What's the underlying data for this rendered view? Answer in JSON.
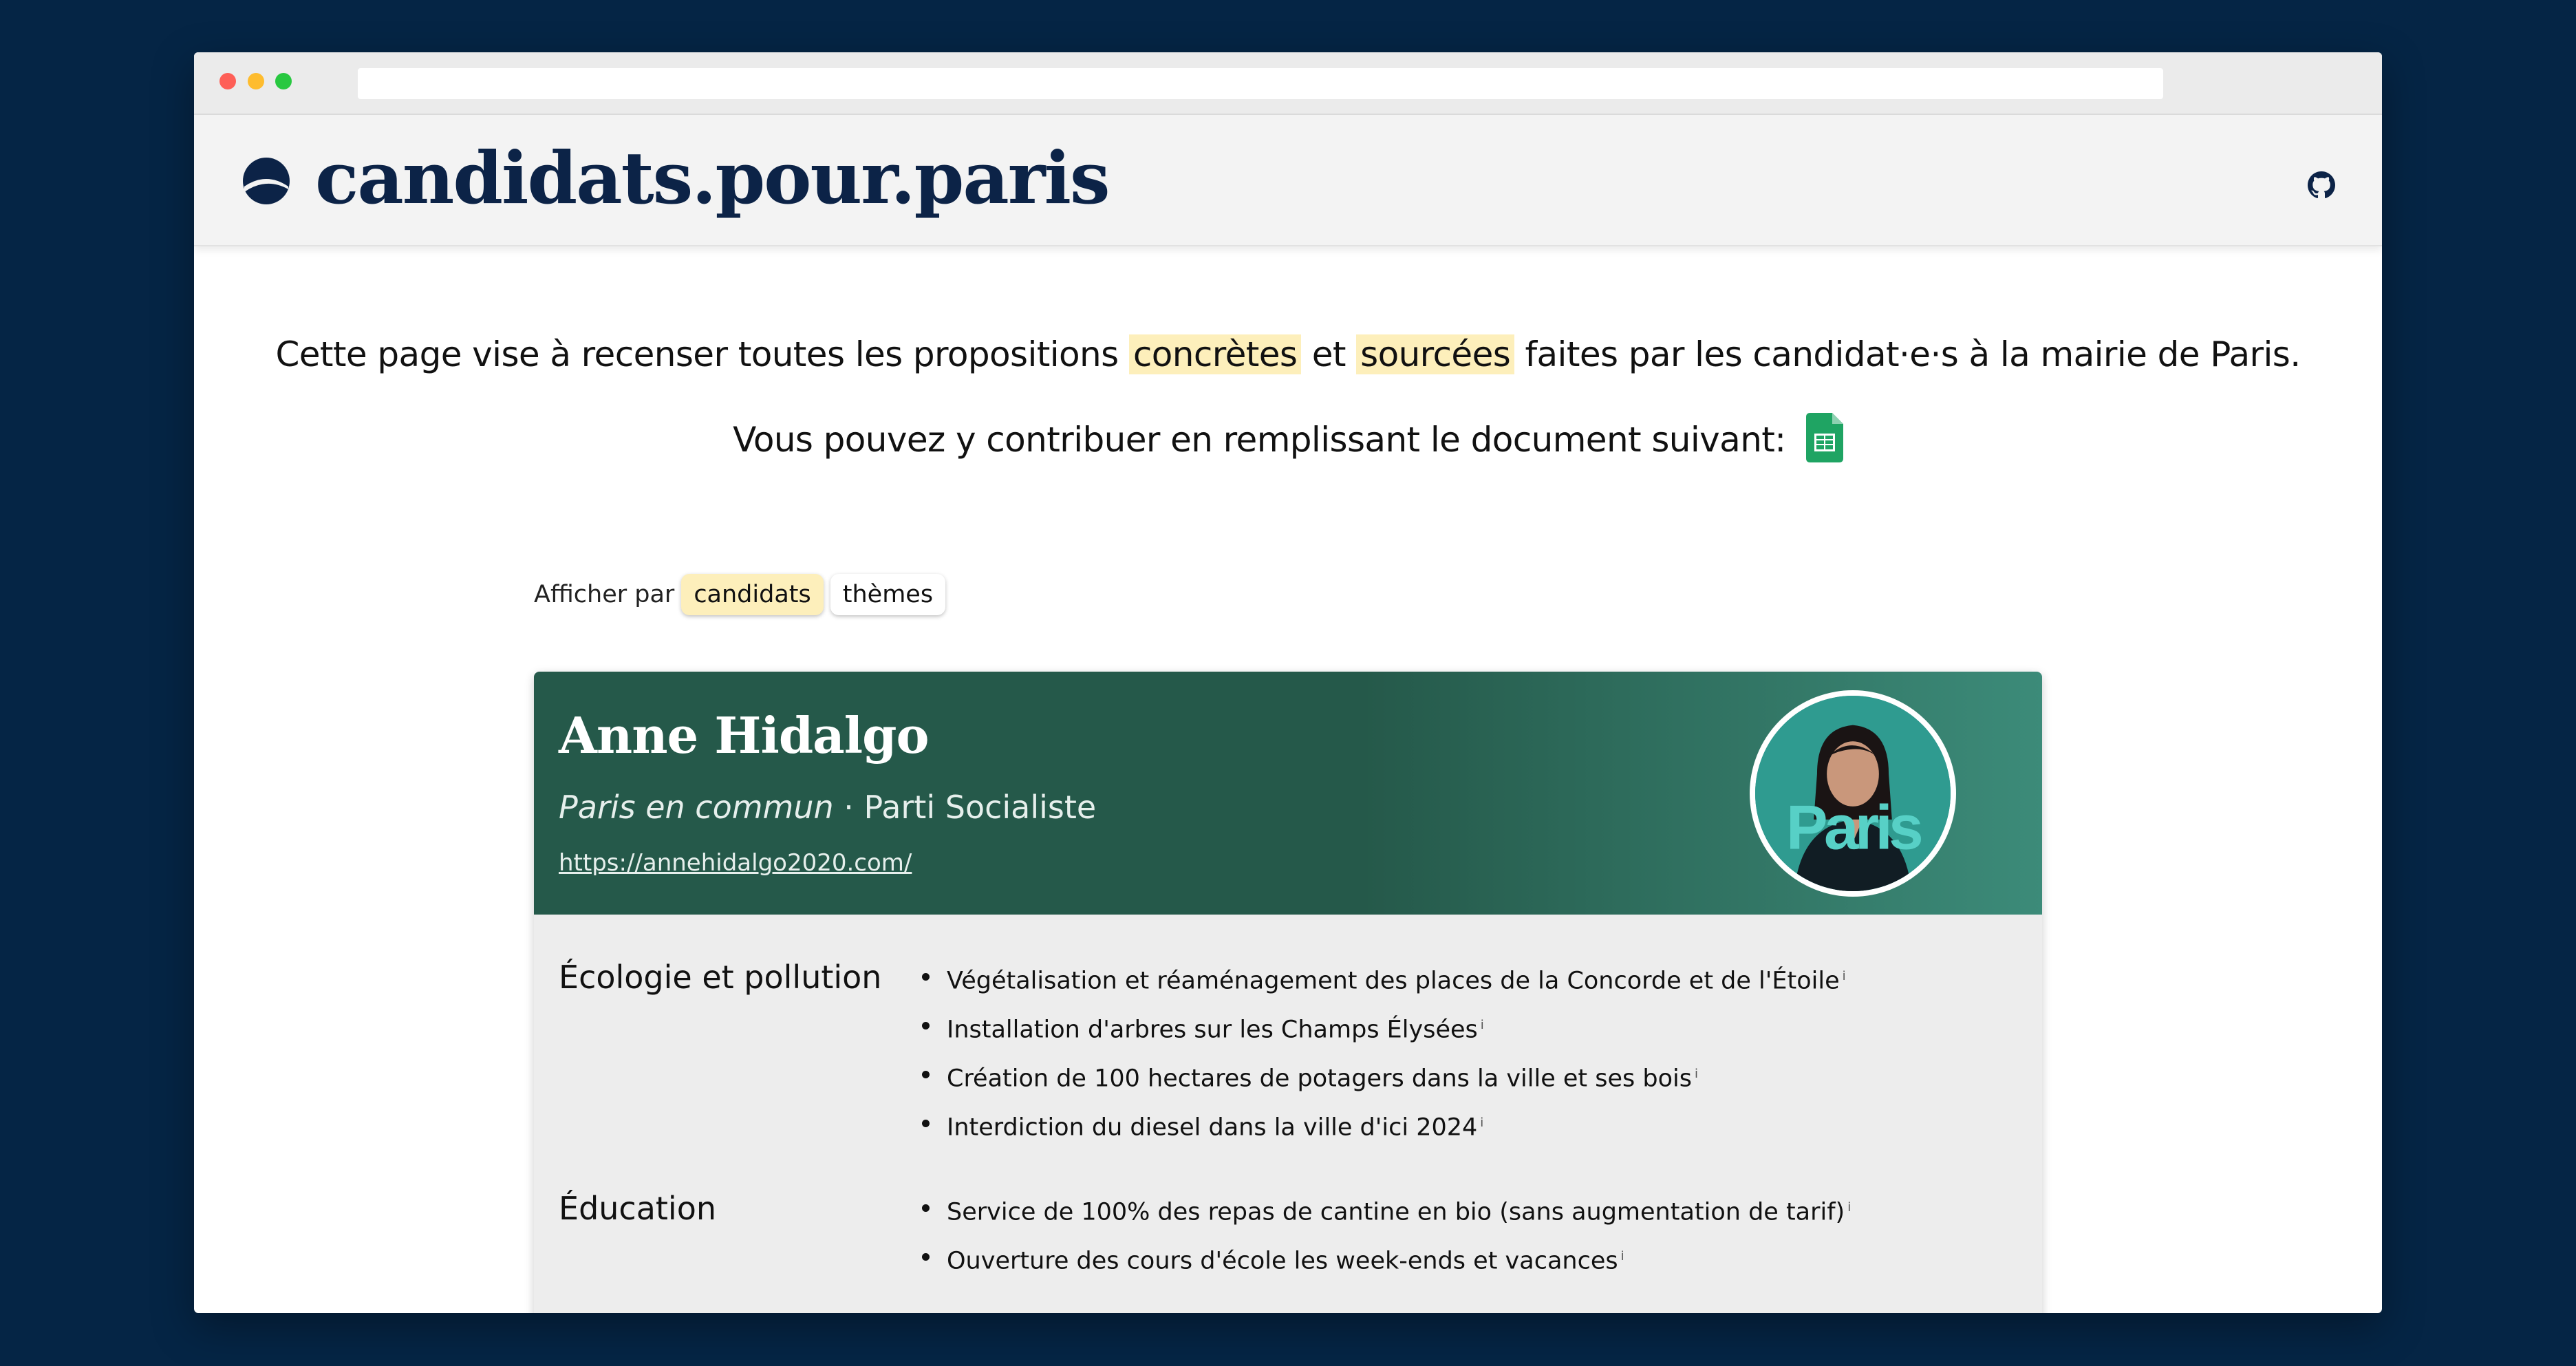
{
  "site": {
    "title": "candidats.pour.paris"
  },
  "intro": {
    "line1_pre": "Cette page vise à recenser toutes les propositions",
    "line1_hl1": "concrètes",
    "line1_mid": "et",
    "line1_hl2": "sourcées",
    "line1_post": "faites par les candidat·e·s à la mairie de Paris.",
    "line2": "Vous pouvez y contribuer en remplissant le document suivant:"
  },
  "filter": {
    "label": "Afficher par",
    "options": [
      "candidats",
      "thèmes"
    ],
    "selected": "candidats"
  },
  "candidate": {
    "name": "Anne Hidalgo",
    "list": "Paris en commun",
    "separator": "·",
    "party": "Parti Socialiste",
    "url": "https://annehidalgo2020.com/",
    "avatar_text": "Paris"
  },
  "themes": [
    {
      "title": "Écologie et pollution",
      "proposals": [
        "Végétalisation et réaménagement des places de la Concorde et de l'Étoile",
        "Installation d'arbres sur les Champs Élysées",
        "Création de 100 hectares de potagers dans la ville et ses bois",
        "Interdiction du diesel dans la ville d'ici 2024"
      ]
    },
    {
      "title": "Éducation",
      "proposals": [
        "Service de 100% des repas de cantine en bio (sans augmentation de tarif)",
        "Ouverture des cours d'école les week-ends et vacances"
      ]
    }
  ],
  "info_marker": "i",
  "colors": {
    "page_bg": "#052545",
    "brand_navy": "#0c2347",
    "highlight": "#fdefbb",
    "card_green": "#25594a"
  },
  "icons": {
    "logo": "candidats-logo-icon",
    "github": "github-icon",
    "sheets": "google-sheets-icon"
  }
}
